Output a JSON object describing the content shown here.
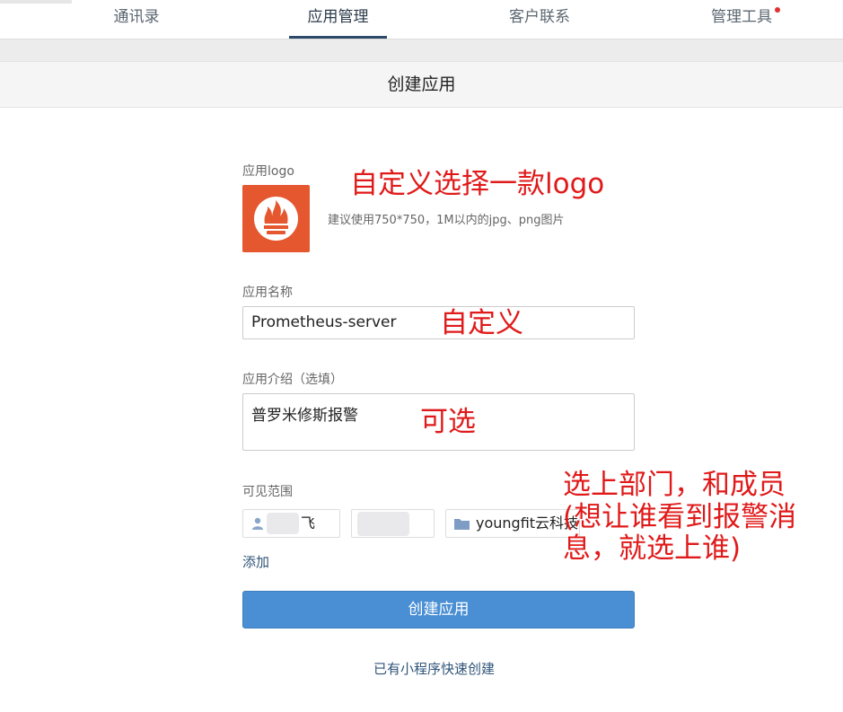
{
  "nav": {
    "tabs": [
      {
        "label": "通讯录"
      },
      {
        "label": "应用管理"
      },
      {
        "label": "客户联系"
      },
      {
        "label": "管理工具"
      }
    ]
  },
  "page": {
    "title": "创建应用"
  },
  "form": {
    "logo_label": "应用logo",
    "logo_hint": "建议使用750*750，1M以内的jpg、png图片",
    "name_label": "应用名称",
    "name_value": "Prometheus-server",
    "intro_label": "应用介绍（选填）",
    "intro_value": "普罗米修斯报警",
    "scope_label": "可见范围",
    "scope_items": [
      {
        "text": "飞"
      },
      {
        "text": ""
      },
      {
        "text": "youngfit云科技"
      }
    ],
    "add_label": "添加",
    "submit_label": "创建应用",
    "quick_create_label": "已有小程序快速创建"
  },
  "annotations": {
    "logo": "自定义选择一款logo",
    "name": "自定义",
    "intro": "可选",
    "scope": "选上部门，和成员\n(想让谁看到报警消\n息，就选上谁)"
  },
  "colors": {
    "annotation_red": "#e01a1a",
    "button_blue": "#4a8fd4",
    "logo_orange": "#e5572f",
    "nav_active_underline": "#2e4a6b"
  },
  "icons": {
    "logo": "prometheus-flame-icon",
    "person": "person-icon",
    "folder": "folder-icon"
  }
}
